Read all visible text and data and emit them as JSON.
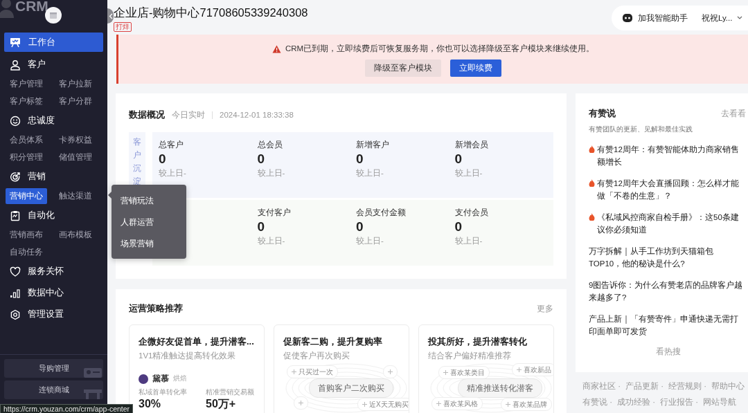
{
  "sidebar": {
    "logo_text": "CRM",
    "sections": [
      {
        "kind": "primary",
        "label": "工作台",
        "selected": true
      },
      {
        "kind": "group",
        "label": "客户",
        "selected": false,
        "children": [
          {
            "label": "客户管理",
            "selected": false
          },
          {
            "label": "客户拉新",
            "selected": false
          },
          {
            "label": "客户标签",
            "selected": false
          },
          {
            "label": "客户分群",
            "selected": false
          }
        ]
      },
      {
        "kind": "group",
        "label": "忠诚度",
        "selected": false,
        "children": [
          {
            "label": "会员体系",
            "selected": false
          },
          {
            "label": "卡券权益",
            "selected": false
          },
          {
            "label": "积分管理",
            "selected": false
          },
          {
            "label": "储值管理",
            "selected": false
          }
        ]
      },
      {
        "kind": "group",
        "label": "营销",
        "selected": false,
        "children": [
          {
            "label": "营销中心",
            "selected": true
          },
          {
            "label": "触达渠道",
            "selected": false
          }
        ]
      },
      {
        "kind": "group",
        "label": "自动化",
        "selected": false,
        "children": [
          {
            "label": "营销画布",
            "selected": false
          },
          {
            "label": "画布模板",
            "selected": false
          },
          {
            "label": "自动任务",
            "selected": false
          }
        ]
      },
      {
        "kind": "group",
        "label": "服务关怀",
        "selected": false
      },
      {
        "kind": "group",
        "label": "数据中心",
        "selected": false
      },
      {
        "kind": "group",
        "label": "管理设置",
        "selected": false
      }
    ],
    "bottom_buttons": [
      "导购管理",
      "连锁商城"
    ]
  },
  "popup_menu": {
    "items": [
      "营销玩法",
      "人群运营",
      "场景营销"
    ]
  },
  "status_url": "https://crm.youzan.com/crm/app-center",
  "header": {
    "title": "企业店-购物中心71708605339240308",
    "tag": "打烊",
    "assistant": "加我智能助手",
    "user": "祝祝Ly..."
  },
  "alert": {
    "message": "CRM已到期，立即续费后可恢复服务期，你也可以选择降级至客户模块来继续使用。",
    "buttons": [
      {
        "label": "降级至客户模块",
        "kind": "secondary"
      },
      {
        "label": "立即续费",
        "kind": "primary"
      }
    ]
  },
  "overview": {
    "title": "数据概况",
    "realtime": "今日实时",
    "time": "2024-12-01 18:33:38",
    "groups": [
      {
        "label": "客户沉淀",
        "metrics": [
          {
            "label": "总客户",
            "value": "0",
            "compare": "较上日-"
          },
          {
            "label": "总会员",
            "value": "0",
            "compare": "较上日-"
          },
          {
            "label": "新增客户",
            "value": "0",
            "compare": "较上日-"
          },
          {
            "label": "新增会员",
            "value": "0",
            "compare": "较上日-"
          }
        ]
      },
      {
        "metrics": [
          {
            "label": "支付客户",
            "value": "0",
            "compare": "较上日-"
          },
          {
            "label": "会员支付金额",
            "value": "0",
            "compare": "较上日-"
          },
          {
            "label": "支付会员",
            "value": "0",
            "compare": "较上日-"
          }
        ]
      }
    ]
  },
  "strategy": {
    "title": "运营策略推荐",
    "more": "更多",
    "cards": [
      {
        "kind": "case",
        "title": "企微好友促首单，提升潜客...",
        "subtitle": "1V1精准触达提高转化效果",
        "brand": "黛慕",
        "brand_tag": "烘焙",
        "stats": [
          {
            "label": "私域首单转化率",
            "value": "30%"
          },
          {
            "label": "精准营销交易额",
            "value": "50万+"
          }
        ]
      },
      {
        "kind": "diagram",
        "title": "促新客二购，提升复购率",
        "subtitle": "促使客户再次购买",
        "center": "首购客户二次购买",
        "tags": [
          "只买过一次",
          "近X天无购买"
        ]
      },
      {
        "kind": "diagram",
        "title": "投其所好，提升潜客转化",
        "subtitle": "结合客户偏好精准推荐",
        "center": "精准推送转化潜客",
        "tags": [
          "喜欢某类目",
          "喜欢新品",
          "喜欢某风格",
          "喜欢某品牌"
        ]
      }
    ]
  },
  "news": {
    "title": "有赞说",
    "link": "去看看",
    "subtitle": "有赞团队的更新、见解和最佳实践",
    "items": [
      {
        "text": "有赞12周年：有赞智能体助力商家销售额增长",
        "hot": true
      },
      {
        "text": "有赞12周年大会直播回顾：怎么样才能做「不卷的生意」？",
        "hot": true
      },
      {
        "text": "《私域风控商家自检手册》：这50条建议你必须知道",
        "hot": true
      },
      {
        "text": "万字拆解｜从手工作坊到天猫箱包TOP10，他的秘诀是什么?",
        "hot": false
      },
      {
        "text": "9图告诉你：为什么有赞老店的品牌客户越来越多了?",
        "hot": false
      },
      {
        "text": "产品上新｜「有赞寄件」申通快递无需打印面单即可发货",
        "hot": false
      }
    ],
    "more": "看热搜"
  },
  "footer_links": [
    [
      "商家社区 ·",
      "产品更新 ·",
      "经营规则 ·",
      "帮助中心"
    ],
    [
      "有赞说 ·",
      "成功经验 ·",
      "行业报告 ·",
      "网站导航"
    ]
  ]
}
